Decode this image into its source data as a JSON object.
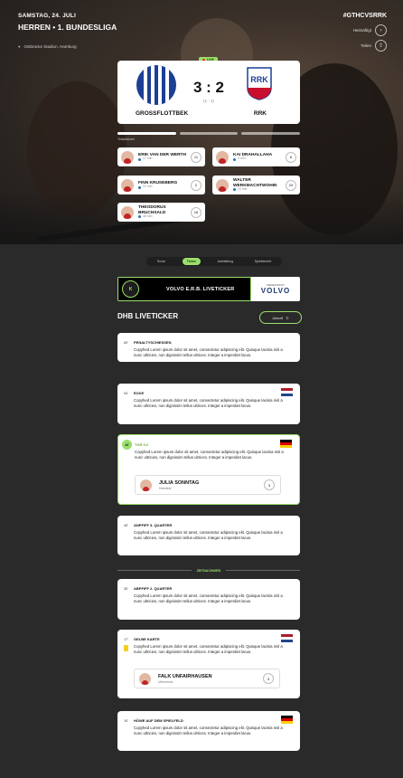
{
  "header": {
    "date": "SAMSTAG, 24. JULI",
    "league": "HERREN • 1. BUNDESLIGA",
    "hashtag": "#GTHCVSRRK",
    "home_link": "Heimaftigt",
    "venue": "Ostbrücke Stadion, Hamburg"
  },
  "match": {
    "status": "LIVE",
    "score": "3 : 2",
    "halftime": "(1 : 1)",
    "home_team": "GROSSFLOTTBEK",
    "away_team": "RRK",
    "away_crest_text": "RRK",
    "scorers_label": "Torschützen"
  },
  "scorers": {
    "home": [
      {
        "name": "ERIK VAN DER WERTH",
        "minute": "17 min",
        "count": "11"
      },
      {
        "name": "FINN KRUSEBERG",
        "minute": "22 min",
        "count": "2"
      },
      {
        "name": "THEODORUS BRUCHSALD",
        "minute": "48 min",
        "count": "16"
      }
    ],
    "away": [
      {
        "name": "KAI DRAHALLAHA",
        "minute": "4 min",
        "count": "6"
      },
      {
        "name": "WALTER WERKMACHTWOHIN",
        "minute": "23 min",
        "count": "24"
      }
    ]
  },
  "nav": {
    "tabs": [
      "Score",
      "Ticker",
      "Aufstellung",
      "Spielbericht"
    ]
  },
  "sponsor": {
    "logo": "K",
    "title": "VOLVO E.R.B. LIVETICKER",
    "presented": "PRESENTED BY",
    "brand": "VOLVO"
  },
  "ticker": {
    "title": "DHB LIVETICKER",
    "filter_label": "Aktuell"
  },
  "events": [
    {
      "minute": "60'",
      "title": "PENALTYSCHIESSEN",
      "text": "Copyhed Lorem ipsum dolor sit amet, consectetur adipiscing elit. Quisque lacinia nisl a nunc ultricies, non dignissim tellus ultrices. Integer a imperdiet lacus."
    },
    {
      "minute": "54'",
      "title": "ECKE",
      "text": "Copyhed Lorem ipsum dolor sit amet, consectetur adipiscing elit. Quisque lacinia nisl a nunc ultricies, non dignissim tellus ultrices. Integer a imperdiet lacus."
    },
    {
      "minute": "48'",
      "title": "TOR 3:2",
      "text": "Copyhed Lorem ipsum dolor sit amet, consectetur adipiscing elit. Quisque lacinia nisl a nunc ultricies, non dignissim tellus ultrices. Integer a imperdiet lacus.",
      "player": "JULIA SONNTAG",
      "player_sub": "Heimfeld",
      "player_count": "3"
    },
    {
      "minute": "45'",
      "title": "ANPFIFF 3. QUARTER",
      "text": "Copyhed Lorem ipsum dolor sit amet, consectetur adipiscing elit. Quisque lacinia nisl a nunc ultricies, non dignissim tellus ultrices. Integer a imperdiet lacus."
    },
    {
      "minute": "30'",
      "title": "ABPFIFF 2. QUARTER",
      "text": "Copyhed Lorem ipsum dolor sit amet, consectetur adipiscing elit. Quisque lacinia nisl a nunc ultricies, non dignissim tellus ultrices. Integer a imperdiet lacus."
    },
    {
      "minute": "17'",
      "title": "GELBE KARTE",
      "text": "Copyhed Lorem ipsum dolor sit amet, consectetur adipiscing elit. Quisque lacinia nisl a nunc ultricies, non dignissim tellus ultrices. Integer a imperdiet lacus.",
      "player": "FALK UNFAIRHAUSEN",
      "player_sub": "Uhlenhorst",
      "player_count": "3"
    },
    {
      "minute": "10'",
      "title": "HÖWE AUF DEM SPIELFELD",
      "text": "Copyhed Lorem ipsum dolor sit amet, consectetur adipiscing elit. Quisque lacinia nisl a nunc ultricies, non dignissim tellus ultrices. Integer a imperdiet lacus."
    }
  ],
  "divider_label": "ZEITNACHWEIS"
}
